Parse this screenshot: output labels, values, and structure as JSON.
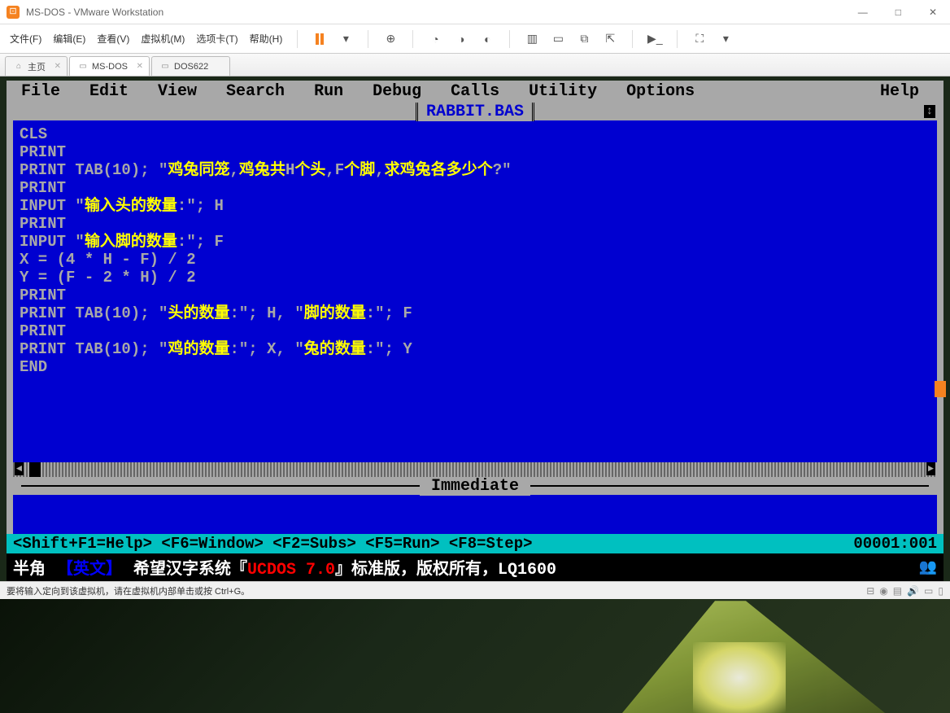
{
  "window": {
    "title": "MS-DOS - VMware Workstation",
    "controls": {
      "min": "—",
      "max": "□",
      "close": "✕"
    }
  },
  "menubar": {
    "items": [
      "文件(F)",
      "编辑(E)",
      "查看(V)",
      "虚拟机(M)",
      "选项卡(T)",
      "帮助(H)"
    ]
  },
  "tabs": [
    {
      "label": "主页",
      "icon": "⌂"
    },
    {
      "label": "MS-DOS",
      "icon": "▭",
      "active": true
    },
    {
      "label": "DOS622",
      "icon": "▭"
    }
  ],
  "qb": {
    "menu": [
      "File",
      "Edit",
      "View",
      "Search",
      "Run",
      "Debug",
      "Calls",
      "Utility",
      "Options"
    ],
    "help": "Help",
    "filename": "RABBIT.BAS",
    "immediate": "Immediate",
    "status_keys": "<Shift+F1=Help> <F6=Window> <F2=Subs> <F5=Run> <F8=Step>",
    "status_pos": "00001:001",
    "code": [
      "CLS",
      "PRINT",
      "PRINT TAB(10); \"鸡兔同笼,鸡兔共H个头,F个脚,求鸡兔各多少个?\"",
      "PRINT",
      "INPUT \"输入头的数量:\"; H",
      "PRINT",
      "INPUT \"输入脚的数量:\"; F",
      "X = (4 * H - F) / 2",
      "Y = (F - 2 * H) / 2",
      "PRINT",
      "PRINT TAB(10); \"头的数量:\"; H, \"脚的数量:\"; F",
      "PRINT",
      "PRINT TAB(10); \"鸡的数量:\"; X, \"兔的数量:\"; Y",
      "END"
    ]
  },
  "ucdos": {
    "mode": "半角",
    "lang": "【英文】",
    "text1": "希望汉字系统『",
    "brand": "UCDOS 7.0",
    "text2": "』标准版，版权所有，",
    "printer": "LQ1600"
  },
  "vmware_status": {
    "msg": "要将输入定向到该虚拟机，请在虚拟机内部单击或按 Ctrl+G。"
  }
}
